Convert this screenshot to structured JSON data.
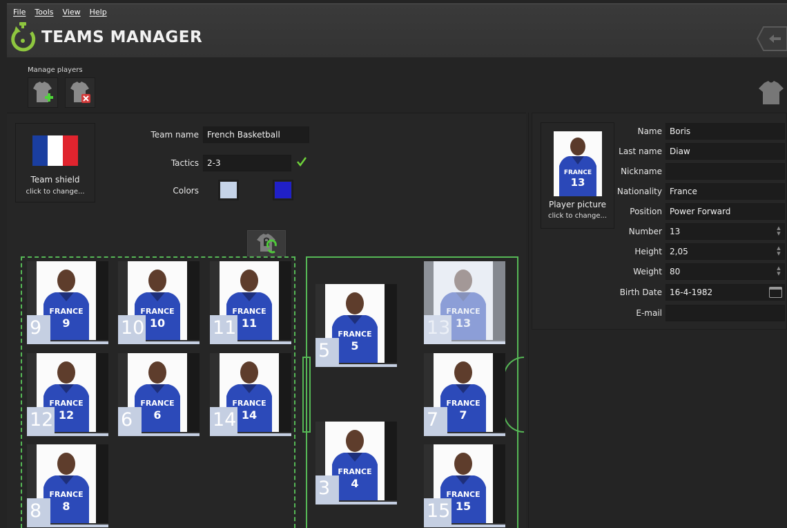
{
  "menu": [
    "File",
    "Tools",
    "View",
    "Help"
  ],
  "app": {
    "title": "TEAMS MANAGER"
  },
  "toolbar": {
    "group_label": "Manage players"
  },
  "team": {
    "shield_caption": "Team shield",
    "shield_hint": "click to change...",
    "name_label": "Team name",
    "name_value": "French Basketball",
    "tactics_label": "Tactics",
    "tactics_value": "2-3",
    "colors_label": "Colors",
    "color_primary": "#c5d3e8",
    "color_secondary": "#2020c8",
    "flag_colors": [
      "#1a3ea0",
      "#ffffff",
      "#e0242e"
    ]
  },
  "bench_players": [
    {
      "number": "9",
      "jersey": "9"
    },
    {
      "number": "10",
      "jersey": "10"
    },
    {
      "number": "11",
      "jersey": "11"
    },
    {
      "number": "12",
      "jersey": "12"
    },
    {
      "number": "6",
      "jersey": "6"
    },
    {
      "number": "14",
      "jersey": "14"
    },
    {
      "number": "8",
      "jersey": "8"
    }
  ],
  "court_players": [
    {
      "number": "5",
      "jersey": "5",
      "faded": false
    },
    {
      "number": "13",
      "jersey": "13",
      "faded": true
    },
    {
      "number": "7",
      "jersey": "7",
      "faded": false
    },
    {
      "number": "3",
      "jersey": "4",
      "faded": false
    },
    {
      "number": "15",
      "jersey": "15",
      "faded": false
    }
  ],
  "player": {
    "picture_caption": "Player picture",
    "picture_hint": "click to change...",
    "picture_jersey": "13",
    "fields": [
      {
        "label": "Name",
        "value": "Boris"
      },
      {
        "label": "Last name",
        "value": "Diaw"
      },
      {
        "label": "Nickname",
        "value": ""
      },
      {
        "label": "Nationality",
        "value": "France"
      },
      {
        "label": "Position",
        "value": "Power Forward"
      },
      {
        "label": "Number",
        "value": "13"
      },
      {
        "label": "Height",
        "value": "2,05"
      },
      {
        "label": "Weight",
        "value": "80"
      },
      {
        "label": "Birth Date",
        "value": "16-4-1982"
      },
      {
        "label": "E-mail",
        "value": ""
      }
    ]
  },
  "icons": {
    "logo": "stopwatch-refresh-icon",
    "back": "back-arrow-icon",
    "add_player": "shirt-add-icon",
    "remove_player": "shirt-remove-icon",
    "player_shirt": "shirt-icon",
    "swap": "shirt-lock-swap-icon",
    "tactics_ok": "check-icon",
    "calendar": "calendar-icon"
  },
  "jersey_text": "FRANCE"
}
